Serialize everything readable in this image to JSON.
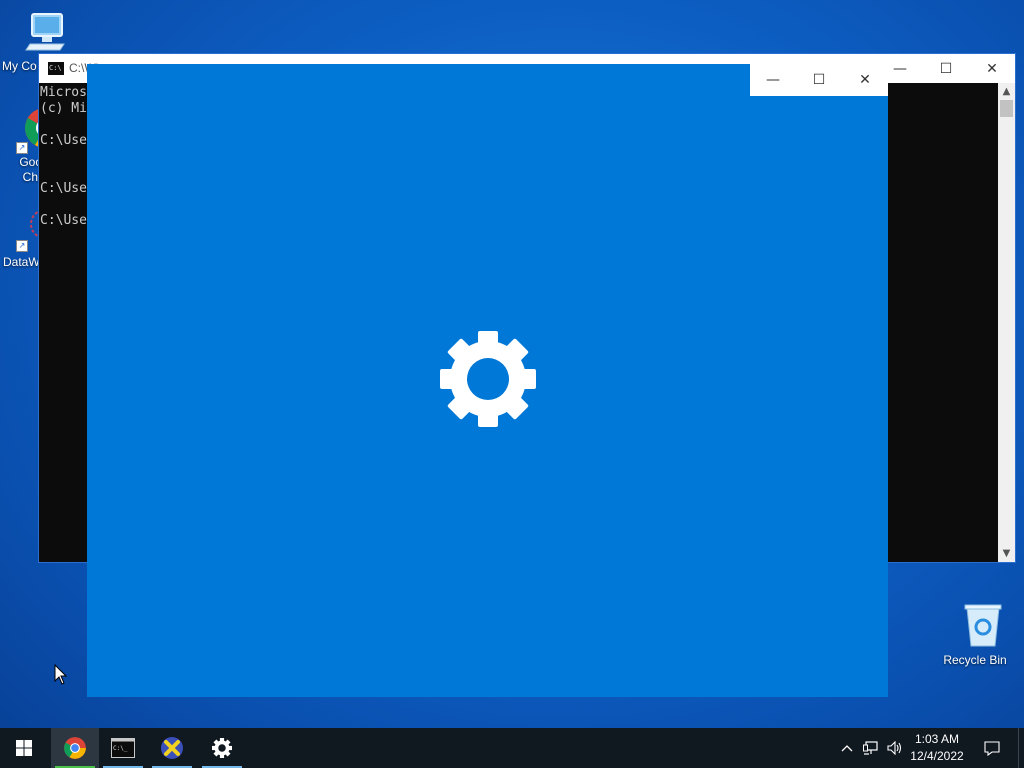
{
  "desktop": {
    "icons": [
      {
        "label": "My Co",
        "name": "my-computer"
      },
      {
        "label": "Goo\nChr",
        "name": "google-chrome"
      },
      {
        "label": "DataW",
        "name": "datawrapper"
      },
      {
        "label": "Recycle Bin",
        "name": "recycle-bin"
      }
    ]
  },
  "cmd_window": {
    "title": "C:\\Wi",
    "icon_text": "C:\\",
    "lines": [
      "Micros",
      "(c) Mi",
      "",
      "C:\\Use",
      "",
      "",
      "C:\\Use",
      "",
      "C:\\Use"
    ],
    "minimize": "—",
    "maximize": "☐",
    "close": "✕"
  },
  "settings_splash": {
    "background": "#0078d7",
    "icon": "gear-icon",
    "minimize": "—",
    "maximize": "☐",
    "close": "✕"
  },
  "taskbar": {
    "items": [
      "start-button",
      "chrome",
      "cmd",
      "app-x",
      "settings"
    ],
    "clock_time": "1:03 AM",
    "clock_date": "12/4/2022",
    "tray_chevron": "^",
    "accent": "#76b9ed"
  }
}
